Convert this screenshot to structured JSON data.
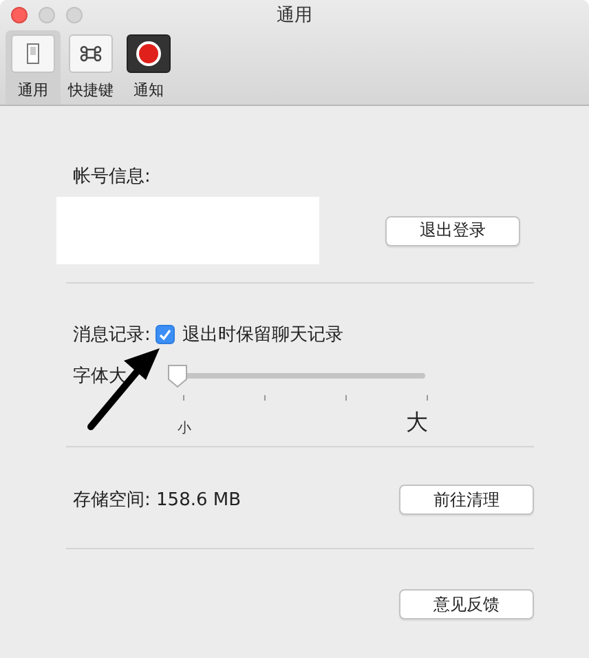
{
  "window": {
    "title": "通用"
  },
  "tabs": [
    {
      "label": "通用",
      "kind": "general",
      "selected": true
    },
    {
      "label": "快捷键",
      "kind": "shortcut",
      "selected": false
    },
    {
      "label": "通知",
      "kind": "notify",
      "selected": false
    }
  ],
  "account": {
    "label": "帐号信息:",
    "button": "退出登录"
  },
  "history": {
    "label": "消息记录:",
    "checkbox": {
      "label": "退出时保留聊天记录",
      "checked": true
    }
  },
  "font_size": {
    "label": "字体大",
    "level": 0,
    "min_label": "小",
    "max_label": "大"
  },
  "storage": {
    "label": "存储空间:",
    "value": "158.6 MB",
    "button": "前往清理"
  },
  "feedback": {
    "button": "意见反馈"
  }
}
